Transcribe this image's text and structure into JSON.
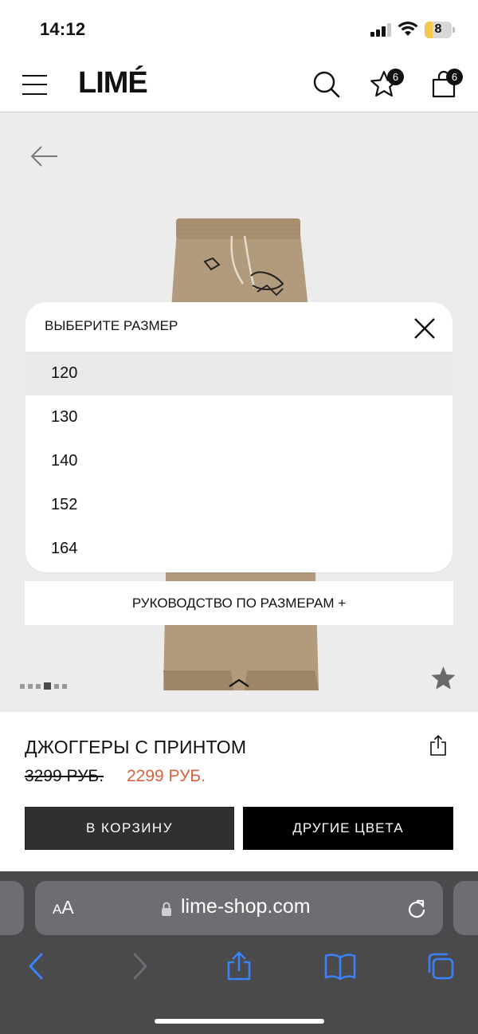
{
  "status_bar": {
    "time": "14:12",
    "battery_level": "8",
    "icons": [
      "cellular-signal-icon",
      "wifi-icon",
      "battery-icon"
    ]
  },
  "header": {
    "logo": "LIMÉ",
    "favorites_count": "6",
    "cart_count": "6",
    "icons": [
      "menu-icon",
      "search-icon",
      "star-icon",
      "shopping-bag-icon"
    ]
  },
  "gallery": {
    "back_icon": "arrow-left-icon",
    "image_count": 6,
    "active_image_index": 4,
    "collapse_icon": "chevron-up-icon",
    "favorite_icon": "star-icon"
  },
  "size_picker": {
    "title": "ВЫБЕРИТЕ РАЗМЕР",
    "close_icon": "close-icon",
    "options": [
      "120",
      "130",
      "140",
      "152",
      "164"
    ],
    "selected": "120"
  },
  "size_guide_label": "РУКОВОДСТВО ПО РАЗМЕРАМ +",
  "product": {
    "title": "ДЖОГГЕРЫ С ПРИНТОМ",
    "old_price": "3299 РУБ.",
    "new_price": "2299 РУБ.",
    "share_icon": "share-icon",
    "add_to_cart_label": "В КОРЗИНУ",
    "other_colors_label": "ДРУГИЕ ЦВЕТА"
  },
  "browser": {
    "text_size_label_small": "A",
    "text_size_label_large": "A",
    "url": "lime-shop.com",
    "icons": [
      "lock-icon",
      "reload-icon",
      "back-icon",
      "forward-icon",
      "share-icon",
      "bookmarks-icon",
      "tabs-icon"
    ]
  },
  "colors": {
    "sale_price": "#d9623e",
    "page_bg": "#ececec",
    "safari_accent": "#3a82f7"
  }
}
